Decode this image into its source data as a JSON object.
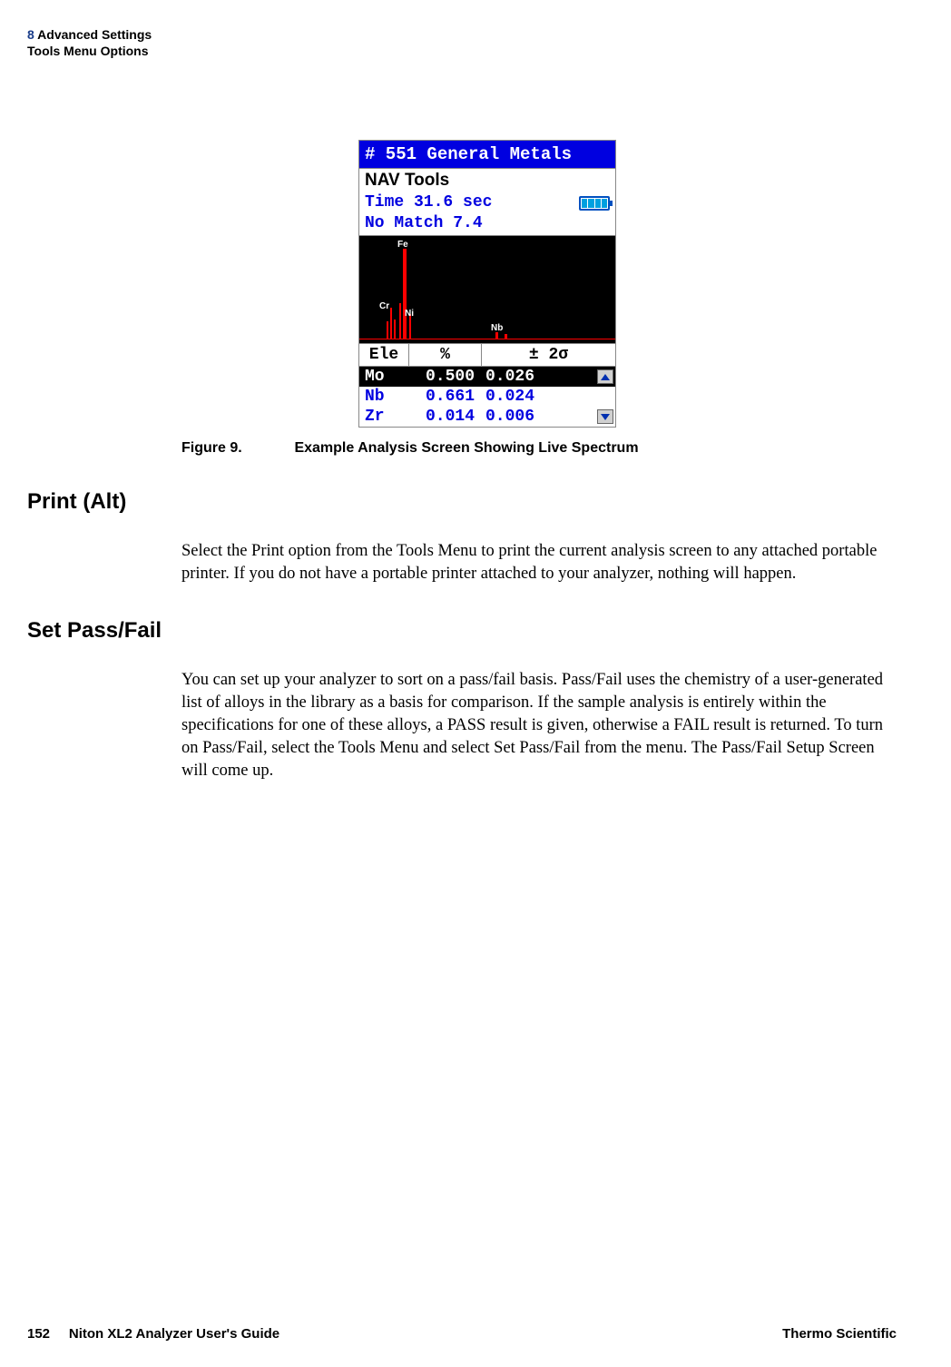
{
  "header": {
    "chapter_num": "8",
    "chapter_title": "Advanced Settings",
    "subtitle": "Tools Menu Options"
  },
  "device": {
    "titlebar": "# 551 General Metals",
    "nav": "NAV Tools",
    "time_line": "Time 31.6 sec",
    "match_line": "No Match 7.4",
    "peaks": {
      "fe": "Fe",
      "cr": "Cr",
      "ni": "Ni",
      "nb": "Nb"
    },
    "table": {
      "headers": {
        "ele": "Ele",
        "pct": "%",
        "sigma": "± 2σ"
      },
      "rows": [
        {
          "ele": "Mo",
          "pct": "0.500",
          "sig": "0.026"
        },
        {
          "ele": "Nb",
          "pct": "0.661",
          "sig": "0.024"
        },
        {
          "ele": "Zr",
          "pct": "0.014",
          "sig": "0.006"
        }
      ]
    }
  },
  "figure": {
    "label": "Figure 9.",
    "text": "Example Analysis Screen Showing Live Spectrum"
  },
  "sections": {
    "print": {
      "heading": "Print (Alt)",
      "body": "Select the Print option from the Tools Menu to print the current analysis screen to any attached portable printer. If you do not have a portable printer attached to your analyzer, nothing will happen."
    },
    "passfail": {
      "heading": "Set Pass/Fail",
      "body": "You can set up your analyzer to sort on a pass/fail basis. Pass/Fail uses the chemistry of a user-generated list of alloys in the library as a basis for comparison. If the sample analysis is entirely within the specifications for one of these alloys, a PASS result is given, otherwise a FAIL result is returned. To turn on Pass/Fail, select the Tools Menu and select Set Pass/Fail from the menu. The Pass/Fail Setup Screen will come up."
    }
  },
  "footer": {
    "page": "152",
    "guide": "Niton XL2 Analyzer User's Guide",
    "company": "Thermo Scientific"
  }
}
